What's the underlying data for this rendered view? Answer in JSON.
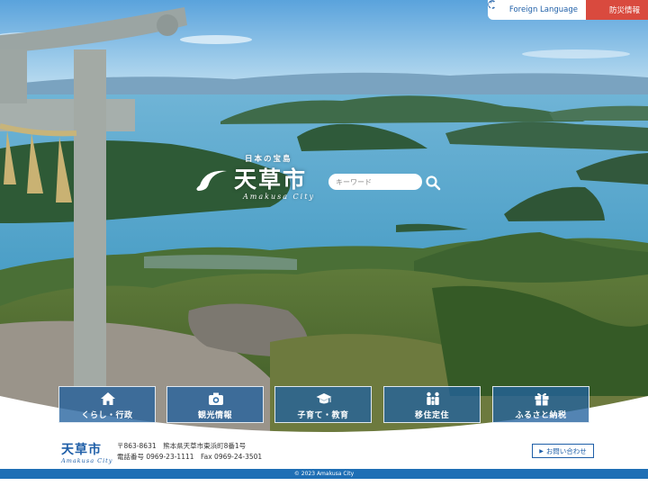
{
  "topbar": {
    "foreign_language": "Foreign Language",
    "disaster_info": "防災情報"
  },
  "logo": {
    "tagline": "日本の宝島",
    "name": "天草市",
    "roman": "Amakusa City"
  },
  "search": {
    "placeholder": "キーワード"
  },
  "menu": {
    "items": [
      {
        "label": "くらし・行政",
        "icon": "home-icon"
      },
      {
        "label": "観光情報",
        "icon": "camera-icon"
      },
      {
        "label": "子育て・教育",
        "icon": "graduation-cap-icon"
      },
      {
        "label": "移住定住",
        "icon": "family-icon"
      },
      {
        "label": "ふるさと納税",
        "icon": "gift-icon"
      }
    ]
  },
  "footer": {
    "logo_name": "天草市",
    "logo_roman": "Amakusa City",
    "address": "〒863-8631　熊本県天草市東浜町8番1号",
    "phone": "電話番号 0969-23-1111　Fax 0969-24-3501",
    "contact_label": "お問い合わせ",
    "copyright": "© 2023 Amakusa City"
  },
  "colors": {
    "brand_blue": "#1f6fb5",
    "disaster_red": "#d94a3e"
  }
}
